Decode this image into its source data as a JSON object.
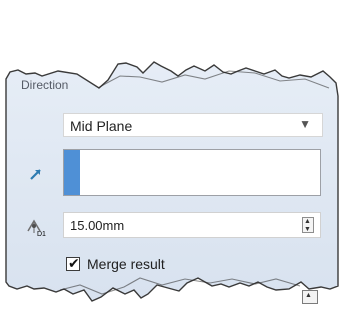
{
  "panel": {
    "title": "Direction"
  },
  "direction": {
    "type_label": "Mid Plane"
  },
  "offset": {
    "value": "15.00mm",
    "field_label": "D1"
  },
  "options": {
    "merge_result_label": "Merge result",
    "merge_result_checked": true
  },
  "icons": {
    "direction_arrow": "arrow-up-right-icon",
    "distance_dimension": "distance-dimension-icon",
    "dropdown_chevron": "chevron-down-icon",
    "spin_up": "spin-up-icon",
    "spin_down": "spin-down-icon"
  },
  "colors": {
    "accent": "#4f90d6",
    "arrow_teal": "#2d7bb1",
    "panel_bg": "#dfe8f2"
  }
}
